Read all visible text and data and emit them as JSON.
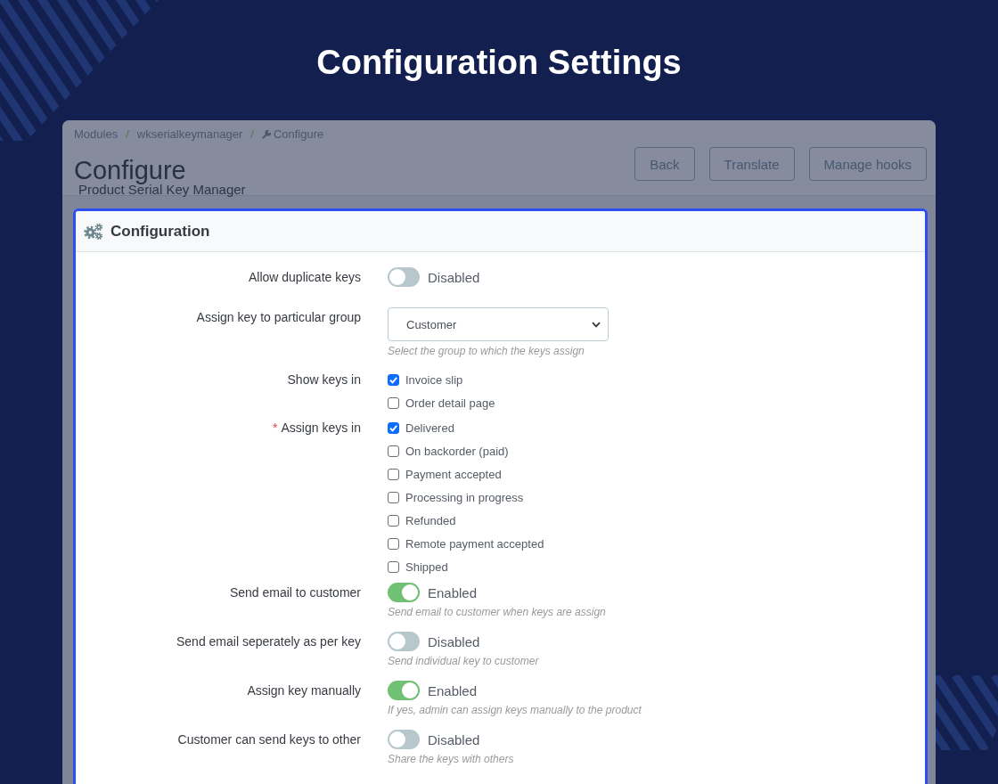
{
  "page_title": "Configuration Settings",
  "breadcrumb": [
    {
      "label": "Modules",
      "separator": "/"
    },
    {
      "label": "wkserialkeymanager",
      "separator": "/"
    },
    {
      "label": "Configure"
    }
  ],
  "header": {
    "title": "Configure",
    "subtitle": "Product Serial Key Manager",
    "buttons": [
      "Back",
      "Translate",
      "Manage hooks"
    ]
  },
  "panel": {
    "title": "Configuration",
    "fields": [
      {
        "kind": "toggle",
        "label": "Allow duplicate keys",
        "on": false,
        "status": "Disabled"
      },
      {
        "kind": "select",
        "label": "Assign key to particular group",
        "value": "Customer",
        "help": "Select the group to which the keys assign"
      },
      {
        "kind": "checkboxes",
        "label": "Show keys in",
        "options": [
          {
            "label": "Invoice slip",
            "checked": true
          },
          {
            "label": "Order detail page",
            "checked": false
          }
        ]
      },
      {
        "kind": "checkboxes",
        "label": "Assign keys in",
        "required_mark": "*",
        "options": [
          {
            "label": "Delivered",
            "checked": true
          },
          {
            "label": "On backorder (paid)",
            "checked": false
          },
          {
            "label": "Payment accepted",
            "checked": false
          },
          {
            "label": "Processing in progress",
            "checked": false
          },
          {
            "label": "Refunded",
            "checked": false
          },
          {
            "label": "Remote payment accepted",
            "checked": false
          },
          {
            "label": "Shipped",
            "checked": false
          }
        ]
      },
      {
        "kind": "toggle",
        "label": "Send email to customer",
        "on": true,
        "status": "Enabled",
        "help": "Send email to customer when keys are assign"
      },
      {
        "kind": "toggle",
        "label": "Send email seperately as per key",
        "on": false,
        "status": "Disabled",
        "help": "Send individual key to customer"
      },
      {
        "kind": "toggle",
        "label": "Assign key manually",
        "on": true,
        "status": "Enabled",
        "help": "If yes, admin can assign keys manually to the product"
      },
      {
        "kind": "toggle",
        "label": "Customer can send keys to other",
        "on": false,
        "status": "Disabled",
        "help": "Share the keys with others"
      }
    ]
  }
}
